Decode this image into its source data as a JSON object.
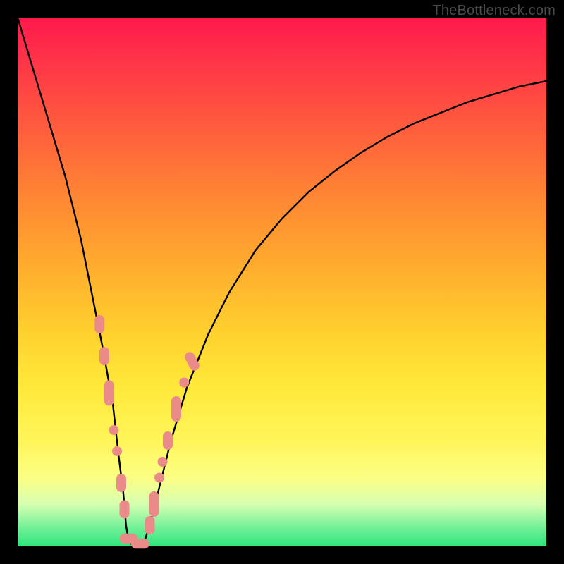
{
  "watermark": {
    "text": "TheBottleneck.com"
  },
  "chart_data": {
    "type": "line",
    "title": "",
    "xlabel": "",
    "ylabel": "",
    "xlim": [
      0,
      100
    ],
    "ylim": [
      0,
      100
    ],
    "series": [
      {
        "name": "bottleneck-curve",
        "x": [
          0,
          3,
          6,
          9,
          12,
          14,
          16,
          18,
          19,
          20,
          20.5,
          21,
          22,
          23,
          24,
          25,
          27,
          29,
          32,
          36,
          40,
          45,
          50,
          55,
          60,
          65,
          70,
          75,
          80,
          85,
          90,
          95,
          100
        ],
        "y": [
          100,
          90,
          80,
          70,
          58,
          48,
          38,
          27,
          18,
          10,
          4,
          1,
          0,
          0,
          1,
          4,
          12,
          20,
          30,
          40,
          48,
          56,
          62,
          67,
          71,
          74.5,
          77.5,
          80,
          82,
          84,
          85.5,
          87,
          88
        ]
      }
    ],
    "markers": [
      {
        "x": 15.5,
        "y": 42,
        "shape": "pill-vert"
      },
      {
        "x": 16.4,
        "y": 36,
        "shape": "pill-vert"
      },
      {
        "x": 17.3,
        "y": 29,
        "shape": "pill-vert-long"
      },
      {
        "x": 18.2,
        "y": 22,
        "shape": "dot"
      },
      {
        "x": 18.8,
        "y": 18,
        "shape": "dot"
      },
      {
        "x": 19.6,
        "y": 12,
        "shape": "pill-vert"
      },
      {
        "x": 20.2,
        "y": 7,
        "shape": "pill-vert"
      },
      {
        "x": 21.0,
        "y": 1.5,
        "shape": "pill-horiz"
      },
      {
        "x": 23.2,
        "y": 0.5,
        "shape": "pill-horiz"
      },
      {
        "x": 25.0,
        "y": 4,
        "shape": "pill-vert"
      },
      {
        "x": 25.8,
        "y": 8,
        "shape": "pill-vert-long"
      },
      {
        "x": 26.8,
        "y": 13,
        "shape": "dot"
      },
      {
        "x": 27.4,
        "y": 16,
        "shape": "dot"
      },
      {
        "x": 28.4,
        "y": 20,
        "shape": "pill-vert"
      },
      {
        "x": 30.0,
        "y": 26,
        "shape": "pill-vert-long"
      },
      {
        "x": 31.5,
        "y": 31,
        "shape": "dot"
      },
      {
        "x": 33.0,
        "y": 35,
        "shape": "pill-diag"
      }
    ],
    "marker_color": "#eb8b89",
    "curve_color": "#000000"
  }
}
